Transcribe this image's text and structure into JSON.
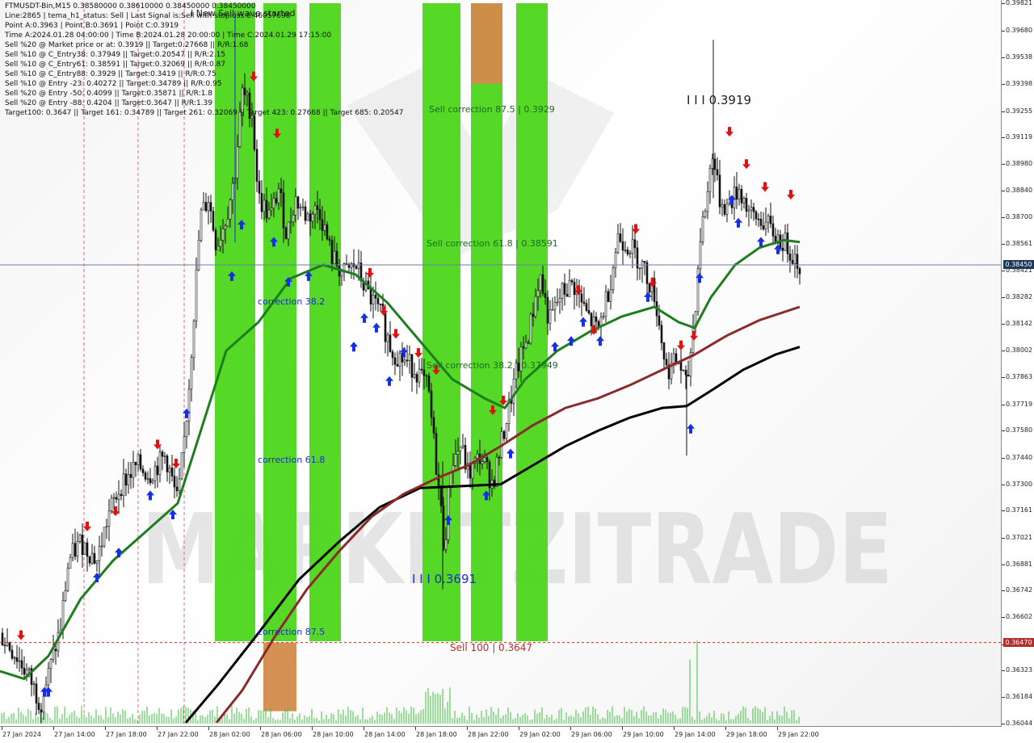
{
  "header": {
    "lines": [
      "FTMUSDT-Bin,M15   0.38580000 0.38610000 0.38450000 0.38450000",
      "Line:2865 | tema_h1_status: Sell | Last Signal is:Sell with stoploss:0.46057698",
      "Point A:0.3963 | Point B:0.3691 | Point C:0.3919",
      "Time A:2024.01.28 04:00:00 | Time B:2024.01.28 20:00:00 | Time C:2024.01.29 17:15:00",
      "Sell %20 @ Market price or at: 0.3919 || Target:0.27668 || R/R:1.68",
      "Sell %10 @ C_Entry38: 0.37949 || Target:0.20547 || R/R:2.15",
      "Sell %10 @ C_Entry61: 0.38591 || Target:0.32069 || R/R:0.87",
      "Sell %10 @ C_Entry88: 0.3929 || Target:0.3419 || R/R:0.75",
      "Sell %10 @ Entry -23: 0.40272 || Target:0.34789 || R/R:0.95",
      "Sell %20 @ Entry -50: 0.4099 || Target:0.35871 || R/R:1.8",
      "Sell %20 @ Entry -88: 0.4204 || Target:0.3647 || R/R:1.39",
      "Target100: 0.3647 || Target 161: 0.34789 || Target 261: 0.32069 || Target 423: 0.27668 || Target 685: 0.20547"
    ]
  },
  "labels": {
    "new_wave": "I New Sell wave started",
    "point_c": "I I I 0.3919",
    "point_b": "I I I 0.3691",
    "sell_corr_875": "Sell correction 87.5 | 0.3929",
    "sell_corr_618": "Sell correction 61.8 | 0.38591",
    "sell_corr_382": "Sell correction 38.2 | 0.37949",
    "corr_382": "correction 38.2",
    "corr_618": "correction 61.8",
    "corr_875": "correction 87.5",
    "sell_100": "Sell 100 | 0.3647",
    "watermark": "MARKETZITRADE"
  },
  "chart_data": {
    "type": "candlestick",
    "symbol": "FTMUSDT-Bin",
    "timeframe": "M15",
    "ylim": [
      0.36045,
      0.39822
    ],
    "y_ticks": [
      "0.39821",
      "0.39680",
      "0.39538",
      "0.39398",
      "0.39255",
      "0.39119",
      "0.38980",
      "0.38840",
      "0.38700",
      "0.38561",
      "0.38421",
      "0.38282",
      "0.38142",
      "0.38002",
      "0.37863",
      "0.37719",
      "0.37580",
      "0.37440",
      "0.37300",
      "0.37161",
      "0.37021",
      "0.36881",
      "0.36742",
      "0.36602",
      "0.36462",
      "0.36323",
      "0.36184",
      "0.36044"
    ],
    "x_ticks": [
      "27 Jan 2024",
      "27 Jan 14:00",
      "27 Jan 18:00",
      "27 Jan 22:00",
      "28 Jan 02:00",
      "28 Jan 06:00",
      "28 Jan 10:00",
      "28 Jan 14:00",
      "28 Jan 18:00",
      "28 Jan 22:00",
      "29 Jan 02:00",
      "29 Jan 06:00",
      "29 Jan 10:00",
      "29 Jan 14:00",
      "29 Jan 18:00",
      "29 Jan 22:00"
    ],
    "current_price": "0.38450",
    "target_price": "0.36470",
    "key_levels": {
      "point_a": 0.3963,
      "point_b": 0.3691,
      "point_c": 0.3919,
      "sell_100": 0.3647
    },
    "close_path": [
      [
        0,
        0.3652
      ],
      [
        20,
        0.364
      ],
      [
        35,
        0.363
      ],
      [
        50,
        0.3615
      ],
      [
        60,
        0.363
      ],
      [
        75,
        0.3655
      ],
      [
        85,
        0.369
      ],
      [
        100,
        0.37
      ],
      [
        120,
        0.369
      ],
      [
        135,
        0.3715
      ],
      [
        150,
        0.373
      ],
      [
        170,
        0.374
      ],
      [
        185,
        0.3735
      ],
      [
        205,
        0.3745
      ],
      [
        220,
        0.372
      ],
      [
        232,
        0.377
      ],
      [
        240,
        0.382
      ],
      [
        248,
        0.387
      ],
      [
        258,
        0.388
      ],
      [
        268,
        0.3855
      ],
      [
        280,
        0.387
      ],
      [
        290,
        0.389
      ],
      [
        300,
        0.3935
      ],
      [
        312,
        0.3925
      ],
      [
        320,
        0.388
      ],
      [
        335,
        0.387
      ],
      [
        345,
        0.3885
      ],
      [
        355,
        0.386
      ],
      [
        365,
        0.388
      ],
      [
        380,
        0.387
      ],
      [
        395,
        0.3875
      ],
      [
        410,
        0.385
      ],
      [
        425,
        0.384
      ],
      [
        440,
        0.3845
      ],
      [
        455,
        0.383
      ],
      [
        470,
        0.382
      ],
      [
        485,
        0.38
      ],
      [
        500,
        0.3795
      ],
      [
        515,
        0.379
      ],
      [
        530,
        0.378
      ],
      [
        545,
        0.372
      ],
      [
        550,
        0.3695
      ],
      [
        558,
        0.374
      ],
      [
        570,
        0.375
      ],
      [
        580,
        0.3735
      ],
      [
        595,
        0.3745
      ],
      [
        610,
        0.373
      ],
      [
        625,
        0.376
      ],
      [
        640,
        0.379
      ],
      [
        655,
        0.381
      ],
      [
        668,
        0.384
      ],
      [
        680,
        0.3815
      ],
      [
        695,
        0.383
      ],
      [
        710,
        0.3835
      ],
      [
        725,
        0.382
      ],
      [
        740,
        0.381
      ],
      [
        755,
        0.3835
      ],
      [
        765,
        0.386
      ],
      [
        780,
        0.3855
      ],
      [
        795,
        0.3845
      ],
      [
        810,
        0.383
      ],
      [
        825,
        0.379
      ],
      [
        840,
        0.3795
      ],
      [
        850,
        0.378
      ],
      [
        860,
        0.382
      ],
      [
        867,
        0.386
      ],
      [
        875,
        0.388
      ],
      [
        882,
        0.3905
      ],
      [
        890,
        0.388
      ],
      [
        900,
        0.3875
      ],
      [
        915,
        0.3885
      ],
      [
        930,
        0.387
      ],
      [
        945,
        0.3868
      ],
      [
        960,
        0.386
      ],
      [
        975,
        0.3855
      ],
      [
        990,
        0.3845
      ]
    ],
    "ma_green": [
      [
        0,
        0.3632
      ],
      [
        30,
        0.3628
      ],
      [
        60,
        0.364
      ],
      [
        100,
        0.367
      ],
      [
        140,
        0.369
      ],
      [
        180,
        0.3705
      ],
      [
        220,
        0.372
      ],
      [
        250,
        0.376
      ],
      [
        280,
        0.38
      ],
      [
        320,
        0.3815
      ],
      [
        360,
        0.3838
      ],
      [
        400,
        0.3845
      ],
      [
        440,
        0.384
      ],
      [
        480,
        0.3825
      ],
      [
        520,
        0.3805
      ],
      [
        560,
        0.3785
      ],
      [
        600,
        0.3775
      ],
      [
        625,
        0.377
      ],
      [
        650,
        0.3785
      ],
      [
        690,
        0.38
      ],
      [
        730,
        0.381
      ],
      [
        770,
        0.3818
      ],
      [
        810,
        0.3823
      ],
      [
        840,
        0.3815
      ],
      [
        860,
        0.3812
      ],
      [
        880,
        0.3828
      ],
      [
        910,
        0.3845
      ],
      [
        940,
        0.3854
      ],
      [
        970,
        0.3858
      ],
      [
        990,
        0.3857
      ]
    ],
    "ma_red": [
      [
        268,
        0.3605
      ],
      [
        300,
        0.3622
      ],
      [
        340,
        0.365
      ],
      [
        380,
        0.3675
      ],
      [
        420,
        0.3695
      ],
      [
        460,
        0.3713
      ],
      [
        500,
        0.3725
      ],
      [
        540,
        0.3733
      ],
      [
        580,
        0.374
      ],
      [
        620,
        0.375
      ],
      [
        660,
        0.3761
      ],
      [
        700,
        0.377
      ],
      [
        740,
        0.3775
      ],
      [
        780,
        0.3782
      ],
      [
        820,
        0.379
      ],
      [
        860,
        0.3798
      ],
      [
        900,
        0.3808
      ],
      [
        940,
        0.3816
      ],
      [
        990,
        0.3823
      ]
    ],
    "ma_black": [
      [
        230,
        0.3605
      ],
      [
        270,
        0.3625
      ],
      [
        320,
        0.3652
      ],
      [
        370,
        0.368
      ],
      [
        420,
        0.37
      ],
      [
        470,
        0.3718
      ],
      [
        520,
        0.3728
      ],
      [
        570,
        0.3729
      ],
      [
        620,
        0.373
      ],
      [
        660,
        0.374
      ],
      [
        700,
        0.375
      ],
      [
        740,
        0.3758
      ],
      [
        780,
        0.3765
      ],
      [
        820,
        0.377
      ],
      [
        850,
        0.3771
      ],
      [
        880,
        0.3779
      ],
      [
        920,
        0.379
      ],
      [
        960,
        0.3798
      ],
      [
        990,
        0.3802
      ]
    ],
    "zones": [
      {
        "x0": 266,
        "x1": 316,
        "color": "#4cd61a"
      },
      {
        "x0": 326,
        "x1": 367,
        "color": "#4cd61a"
      },
      {
        "x0": 326,
        "x1": 367,
        "color": "#d38a4a",
        "y0": 0.3647,
        "y1": 0.3611
      },
      {
        "x0": 383,
        "x1": 422,
        "color": "#4cd61a"
      },
      {
        "x0": 523,
        "x1": 570,
        "color": "#4cd61a"
      },
      {
        "x0": 583,
        "x1": 622,
        "color": "#4cd61a"
      },
      {
        "x0": 583,
        "x1": 622,
        "color": "#d38a4a",
        "y0": 0.39822,
        "y1": 0.394
      },
      {
        "x0": 639,
        "x1": 678,
        "color": "#4cd61a"
      }
    ],
    "arrows_down": [
      [
        26,
        0.365
      ],
      [
        108,
        0.3707
      ],
      [
        143,
        0.3715
      ],
      [
        195,
        0.375
      ],
      [
        218,
        0.374
      ],
      [
        314,
        0.3943
      ],
      [
        343,
        0.3913
      ],
      [
        458,
        0.384
      ],
      [
        475,
        0.382
      ],
      [
        490,
        0.3808
      ],
      [
        518,
        0.3798
      ],
      [
        540,
        0.3789
      ],
      [
        610,
        0.3768
      ],
      [
        623,
        0.3773
      ],
      [
        716,
        0.3831
      ],
      [
        735,
        0.381
      ],
      [
        787,
        0.3863
      ],
      [
        808,
        0.3835
      ],
      [
        843,
        0.3802
      ],
      [
        859,
        0.3807
      ],
      [
        903,
        0.3914
      ],
      [
        924,
        0.3897
      ],
      [
        947,
        0.3885
      ],
      [
        979,
        0.3881
      ]
    ],
    "arrows_up": [
      [
        55,
        0.3622
      ],
      [
        60,
        0.3622
      ],
      [
        120,
        0.3682
      ],
      [
        147,
        0.3695
      ],
      [
        186,
        0.3725
      ],
      [
        214,
        0.3715
      ],
      [
        231,
        0.3768
      ],
      [
        287,
        0.384
      ],
      [
        299,
        0.3867
      ],
      [
        339,
        0.3858
      ],
      [
        357,
        0.3837
      ],
      [
        382,
        0.384
      ],
      [
        438,
        0.3803
      ],
      [
        451,
        0.3818
      ],
      [
        466,
        0.3813
      ],
      [
        482,
        0.3785
      ],
      [
        500,
        0.38
      ],
      [
        555,
        0.3712
      ],
      [
        602,
        0.3725
      ],
      [
        632,
        0.3747
      ],
      [
        687,
        0.3803
      ],
      [
        707,
        0.3806
      ],
      [
        722,
        0.3816
      ],
      [
        743,
        0.3806
      ],
      [
        802,
        0.3829
      ],
      [
        866,
        0.3839
      ],
      [
        855,
        0.376
      ],
      [
        906,
        0.388
      ],
      [
        914,
        0.3868
      ],
      [
        942,
        0.3858
      ],
      [
        963,
        0.3854
      ]
    ],
    "volume_seed": 7
  }
}
